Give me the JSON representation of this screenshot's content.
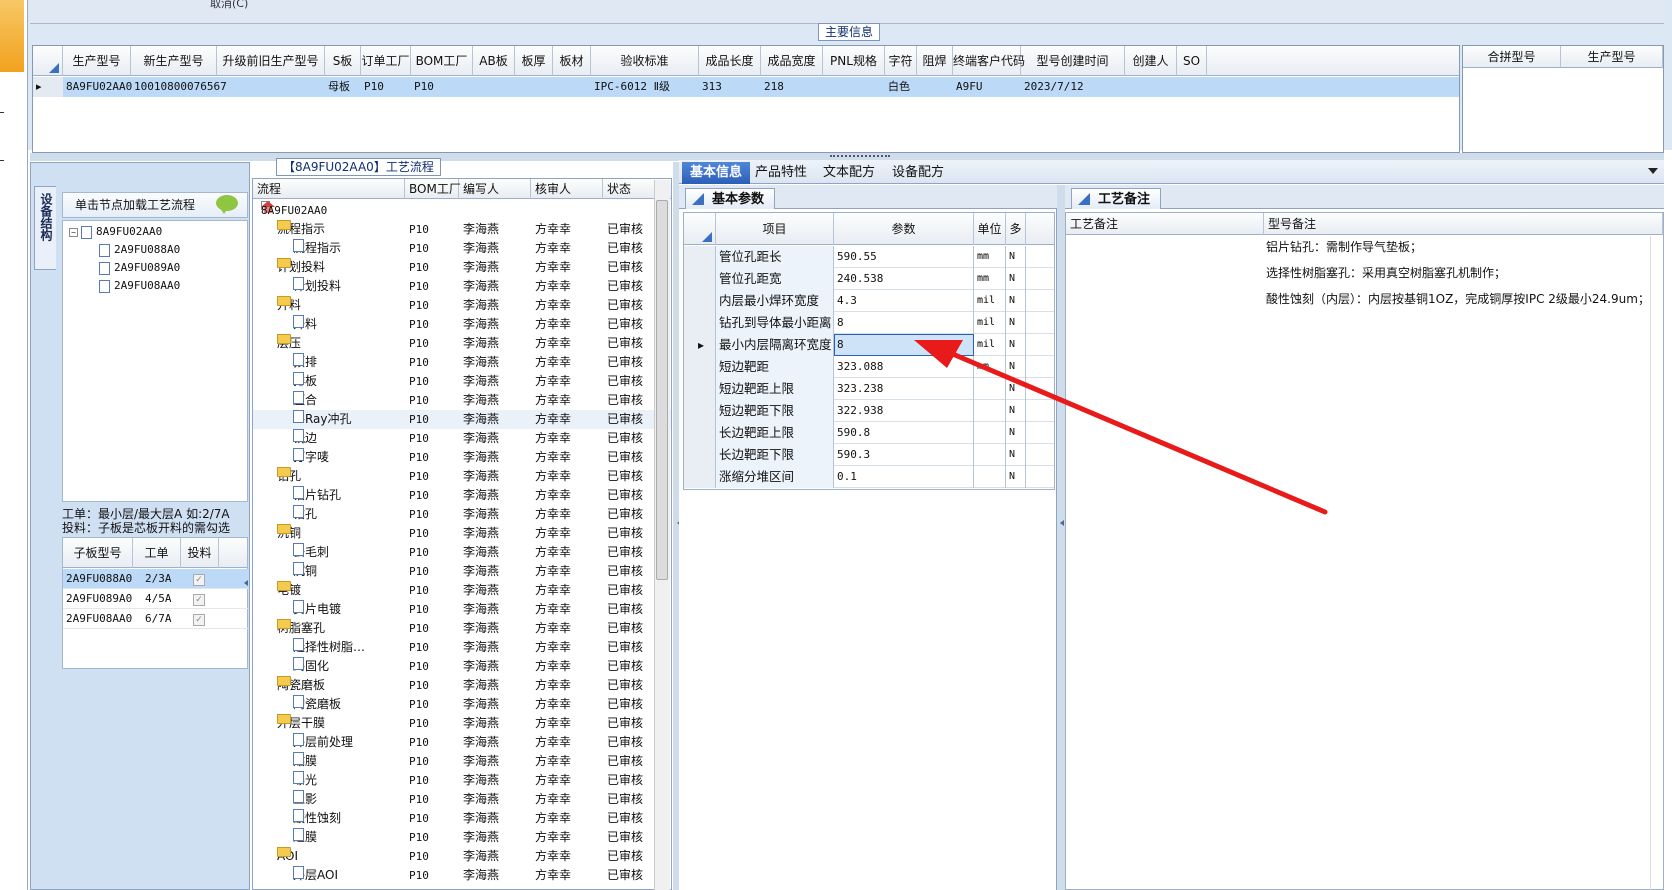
{
  "top": {
    "cut_text": "取消(C)",
    "section_label": "主要信息"
  },
  "main_grid": {
    "columns": [
      "生产型号",
      "新生产型号",
      "升级前旧生产型号",
      "S板",
      "订单工厂",
      "BOM工厂",
      "AB板",
      "板厚",
      "板材",
      "验收标准",
      "成品长度",
      "成品宽度",
      "PNL规格",
      "字符",
      "阻焊",
      "终端客户代码",
      "型号创建时间",
      "创建人",
      "SO"
    ],
    "row": [
      "8A9FU02AA0",
      "10010800076567",
      "",
      "母板",
      "P10",
      "P10",
      "",
      "",
      "",
      "IPC-6012 Ⅱ级",
      "313",
      "218",
      "",
      "白色",
      "",
      "A9FU",
      "2023/7/12",
      "",
      ""
    ]
  },
  "side_grid": {
    "columns": [
      "合拼型号",
      "生产型号"
    ]
  },
  "left_panel": {
    "vertical_tab": "设备结构",
    "hint": "单击节点加载工艺流程",
    "tree": [
      "8A9FU02AA0",
      "2A9FU088A0",
      "2A9FU089A0",
      "2A9FU08AA0"
    ],
    "note_line1": "工单：最小层/最大层A 如:2/7A",
    "note_line2": "投料：子板是芯板开料的需勾选",
    "sub_columns": [
      "子板型号",
      "工单",
      "投料"
    ],
    "sub_rows": [
      {
        "model": "2A9FU088A0",
        "order": "2/3A",
        "checked": "✓"
      },
      {
        "model": "2A9FU089A0",
        "order": "4/5A",
        "checked": "✓"
      },
      {
        "model": "2A9FU08AA0",
        "order": "6/7A",
        "checked": "✓"
      }
    ]
  },
  "flow": {
    "title": "【8A9FU02AA0】工艺流程",
    "columns": [
      "流程",
      "BOM工厂",
      "编写人",
      "核审人",
      "状态"
    ],
    "root": "8A9FU02AA0",
    "factory": "P10",
    "writer": "李海燕",
    "reviewer": "方幸幸",
    "status": "已审核",
    "rows": [
      {
        "name": "流程指示",
        "type": "folder"
      },
      {
        "name": "流程指示",
        "type": "doc"
      },
      {
        "name": "计划投料",
        "type": "folder"
      },
      {
        "name": "计划投料",
        "type": "doc"
      },
      {
        "name": "开料",
        "type": "folder"
      },
      {
        "name": "开料",
        "type": "doc"
      },
      {
        "name": "层压",
        "type": "folder"
      },
      {
        "name": "预排",
        "type": "doc"
      },
      {
        "name": "排板",
        "type": "doc"
      },
      {
        "name": "压合",
        "type": "doc"
      },
      {
        "name": "X-Ray冲孔",
        "type": "doc"
      },
      {
        "name": "铣边",
        "type": "doc"
      },
      {
        "name": "打字唛",
        "type": "doc"
      },
      {
        "name": "钻孔",
        "type": "folder"
      },
      {
        "name": "铝片钻孔",
        "type": "doc"
      },
      {
        "name": "钻孔",
        "type": "doc"
      },
      {
        "name": "沉铜",
        "type": "folder"
      },
      {
        "name": "去毛刺",
        "type": "doc"
      },
      {
        "name": "沉铜",
        "type": "doc"
      },
      {
        "name": "电镀",
        "type": "folder"
      },
      {
        "name": "负片电镀",
        "type": "doc"
      },
      {
        "name": "树脂塞孔",
        "type": "folder"
      },
      {
        "name": "选择性树脂…",
        "type": "doc"
      },
      {
        "name": "终固化",
        "type": "doc"
      },
      {
        "name": "陶瓷磨板",
        "type": "folder"
      },
      {
        "name": "陶瓷磨板",
        "type": "doc"
      },
      {
        "name": "外层干膜",
        "type": "folder"
      },
      {
        "name": "外层前处理",
        "type": "doc"
      },
      {
        "name": "贴膜",
        "type": "doc"
      },
      {
        "name": "曝光",
        "type": "doc"
      },
      {
        "name": "显影",
        "type": "doc"
      },
      {
        "name": "酸性蚀刻",
        "type": "doc"
      },
      {
        "name": "退膜",
        "type": "doc"
      },
      {
        "name": "AOI",
        "type": "folder"
      },
      {
        "name": "外层AOI",
        "type": "doc"
      }
    ]
  },
  "tabs": [
    "基本信息",
    "产品特性",
    "文本配方",
    "设备配方"
  ],
  "basic": {
    "subtab": "基本参数",
    "columns": [
      "项目",
      "参数",
      "单位",
      "多"
    ],
    "rows": [
      {
        "item": "管位孔距长",
        "value": "590.55",
        "unit": "mm",
        "flag": "N"
      },
      {
        "item": "管位孔距宽",
        "value": "240.538",
        "unit": "mm",
        "flag": "N"
      },
      {
        "item": "内层最小焊环宽度",
        "value": "4.3",
        "unit": "mil",
        "flag": "N"
      },
      {
        "item": "钻孔到导体最小距离",
        "value": "8",
        "unit": "mil",
        "flag": "N"
      },
      {
        "item": "最小内层隔离环宽度",
        "value": "8",
        "unit": "mil",
        "flag": "N"
      },
      {
        "item": "短边靶距",
        "value": "323.088",
        "unit": "mm",
        "flag": "N"
      },
      {
        "item": "短边靶距上限",
        "value": "323.238",
        "unit": "",
        "flag": "N"
      },
      {
        "item": "短边靶距下限",
        "value": "322.938",
        "unit": "",
        "flag": "N"
      },
      {
        "item": "长边靶距上限",
        "value": "590.8",
        "unit": "",
        "flag": "N"
      },
      {
        "item": "长边靶距下限",
        "value": "590.3",
        "unit": "",
        "flag": "N"
      },
      {
        "item": "涨缩分堆区间",
        "value": "0.1",
        "unit": "",
        "flag": "N"
      }
    ]
  },
  "notes": {
    "subtab": "工艺备注",
    "columns": [
      "工艺备注",
      "型号备注"
    ],
    "lines": [
      "铝片钻孔：需制作导气垫板；",
      "选择性树脂塞孔：采用真空树脂塞孔机制作；",
      "酸性蚀刻（内层）：内层按基铜1OZ，完成铜厚按IPC 2级最小24.9um；"
    ]
  },
  "colors": {
    "accent": "#2c5fb8",
    "selection": "#bcd9f7",
    "annotation_arrow": "#e81a1a"
  }
}
